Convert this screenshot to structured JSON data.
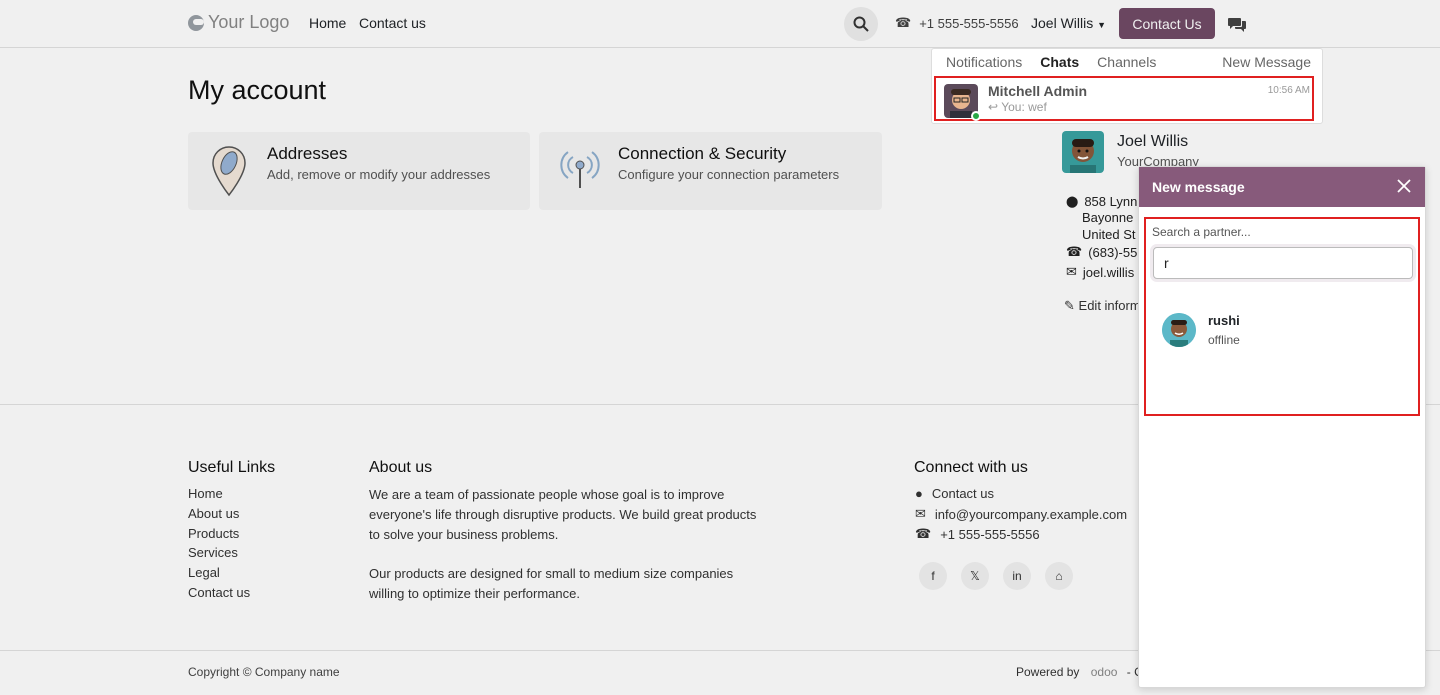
{
  "header": {
    "logo_text": "Your Logo",
    "nav": [
      "Home",
      "Contact us"
    ],
    "phone": "+1 555-555-5556",
    "user_menu": "Joel Willis",
    "contact_button": "Contact Us",
    "accent_color": "#714b67"
  },
  "main": {
    "title": "My account",
    "cards": [
      {
        "title": "Addresses",
        "desc": "Add, remove or modify your addresses",
        "icon": "map-pin-icon"
      },
      {
        "title": "Connection & Security",
        "desc": "Configure your connection parameters",
        "icon": "antenna-icon"
      }
    ],
    "profile": {
      "name": "Joel Willis",
      "company": "YourCompany",
      "address_lines": [
        "858 Lynn",
        "Bayonne",
        "United St"
      ],
      "phone": "(683)-55",
      "email": "joel.willis",
      "edit_label": "Edit inform"
    }
  },
  "footer": {
    "useful_links_title": "Useful Links",
    "useful_links": [
      "Home",
      "About us",
      "Products",
      "Services",
      "Legal",
      "Contact us"
    ],
    "about_title": "About us",
    "about_p1_lines": [
      "We are a team of passionate people whose goal is to improve",
      "everyone's life through disruptive products. We build great products",
      "to solve your business problems."
    ],
    "about_p2_lines": [
      "Our products are designed for small to medium size companies",
      "willing to optimize their performance."
    ],
    "connect_title": "Connect with us",
    "connect_items": [
      {
        "icon": "comment-icon",
        "label": "Contact us"
      },
      {
        "icon": "envelope-icon",
        "label": "info@yourcompany.example.com"
      },
      {
        "icon": "phone-icon",
        "label": "+1 555-555-5556"
      }
    ],
    "social": [
      "f",
      "𝕏",
      "in",
      "⌂"
    ],
    "copyright": "Copyright © Company name",
    "powered_by": "Powered by",
    "powered_brand": "odoo",
    "powered_suffix": "- C"
  },
  "chat_panel": {
    "tabs": [
      "Notifications",
      "Chats",
      "Channels"
    ],
    "active_tab": "Chats",
    "new_message_link": "New Message",
    "conversation": {
      "name": "Mitchell Admin",
      "preview": "You: wef",
      "time": "10:56 AM"
    }
  },
  "new_message_window": {
    "title": "New message",
    "search_label": "Search a partner...",
    "search_value": "r",
    "header_color": "#875a7b",
    "result": {
      "name": "rushi",
      "status": "offline"
    }
  }
}
